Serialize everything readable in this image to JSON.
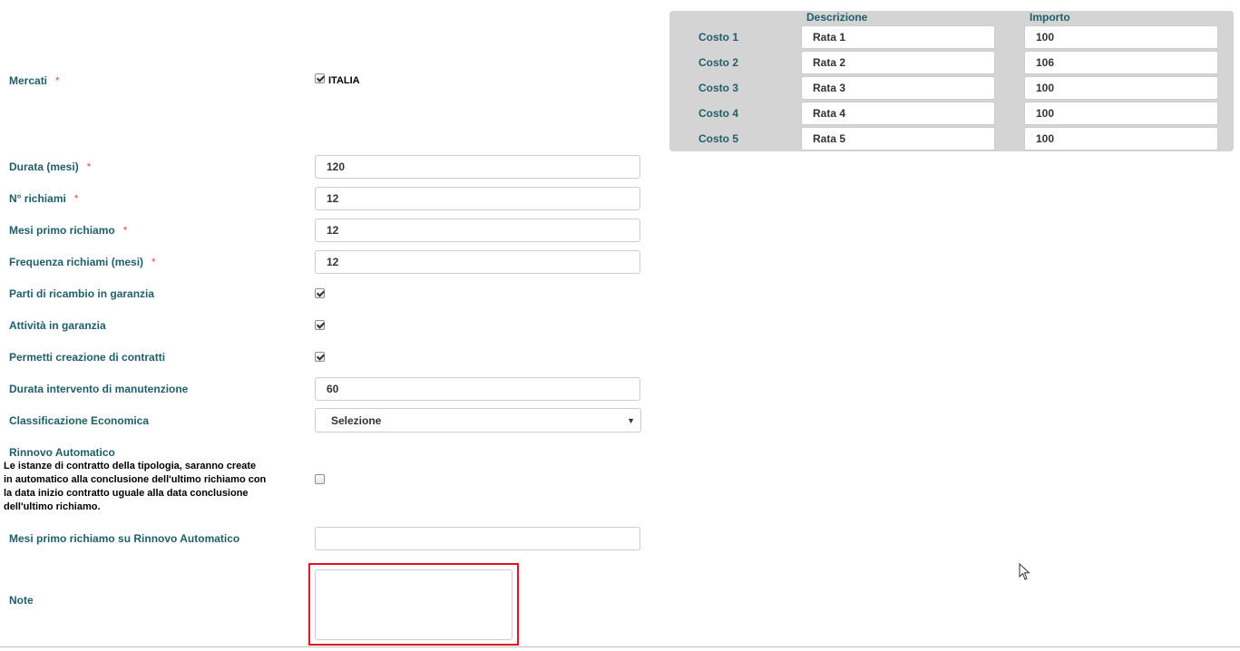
{
  "form": {
    "mercati": {
      "label": "Mercati",
      "option": "ITALIA"
    },
    "durata": {
      "label": "Durata (mesi)",
      "value": "120"
    },
    "n_richiami": {
      "label": "N° richiami",
      "value": "12"
    },
    "mesi_primo": {
      "label": "Mesi primo richiamo",
      "value": "12"
    },
    "frequenza": {
      "label": "Frequenza richiami (mesi)",
      "value": "12"
    },
    "parti": {
      "label": "Parti di ricambio in garanzia"
    },
    "attivita": {
      "label": "Attività in garanzia"
    },
    "permetti": {
      "label": "Permetti creazione di contratti"
    },
    "durata_intervento": {
      "label": "Durata intervento di manutenzione",
      "value": "60"
    },
    "classificazione": {
      "label": "Classificazione Economica",
      "selected": "Selezione"
    },
    "rinnovo": {
      "label": "Rinnovo Automatico",
      "description": "Le istanze di contratto della tipologia, saranno create in automatico alla conclusione dell'ultimo richiamo con la data inizio contratto uguale alla data conclusione dell'ultimo richiamo."
    },
    "mesi_rinnovo": {
      "label": "Mesi primo richiamo su Rinnovo Automatico",
      "value": ""
    },
    "note": {
      "label": "Note",
      "value": ""
    },
    "required_mark": "*"
  },
  "costs": {
    "header_desc": "Descrizione",
    "header_importo": "Importo",
    "rows": [
      {
        "label": "Costo 1",
        "desc": "Rata 1",
        "importo": "100"
      },
      {
        "label": "Costo 2",
        "desc": "Rata 2",
        "importo": "106"
      },
      {
        "label": "Costo 3",
        "desc": "Rata 3",
        "importo": "100"
      },
      {
        "label": "Costo 4",
        "desc": "Rata 4",
        "importo": "100"
      },
      {
        "label": "Costo 5",
        "desc": "Rata 5",
        "importo": "100"
      }
    ]
  },
  "colors": {
    "label": "#1f5e6a",
    "required": "#d9534f",
    "highlight": "#e0141e",
    "panel": "#d4d4d4"
  }
}
